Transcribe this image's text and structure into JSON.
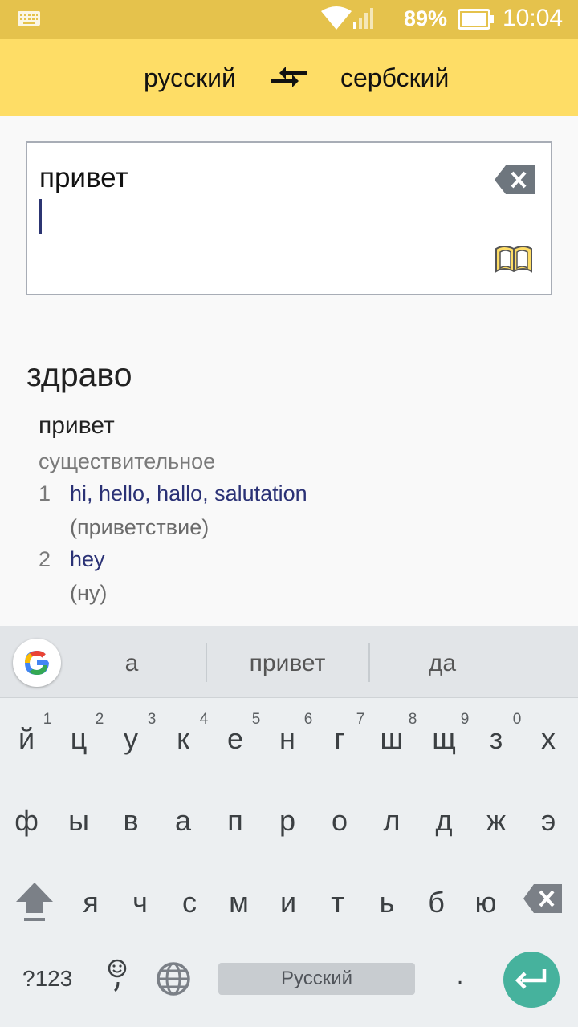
{
  "status_bar": {
    "battery": "89%",
    "time": "10:04",
    "icons": [
      "keyboard-icon",
      "wifi-icon",
      "signal-icon",
      "battery-icon"
    ]
  },
  "language_bar": {
    "source": "русский",
    "target": "сербский",
    "swap_icon": "swap-arrows-icon"
  },
  "input": {
    "text": "привет",
    "clear_icon": "backspace-clear-icon",
    "book_icon": "dictionary-book-icon"
  },
  "result": {
    "translation": "здраво",
    "entry": {
      "word": "привет",
      "part_of_speech": "существительное",
      "senses": [
        {
          "num": "1",
          "translations": "hi, hello, hallo, salutation",
          "gloss": "(приветствие)"
        },
        {
          "num": "2",
          "translations": "hey",
          "gloss": "(ну)"
        }
      ]
    }
  },
  "keyboard": {
    "suggestions": [
      "а",
      "привет",
      "да"
    ],
    "row1": [
      "й",
      "ц",
      "у",
      "к",
      "е",
      "н",
      "г",
      "ш",
      "щ",
      "з",
      "х"
    ],
    "row1_hints": [
      "1",
      "2",
      "3",
      "4",
      "5",
      "6",
      "7",
      "8",
      "9",
      "0"
    ],
    "row2": [
      "ф",
      "ы",
      "в",
      "а",
      "п",
      "р",
      "о",
      "л",
      "д",
      "ж",
      "э"
    ],
    "row3": [
      "я",
      "ч",
      "с",
      "м",
      "и",
      "т",
      "ь",
      "б",
      "ю"
    ],
    "symbols_label": "?123",
    "space_label": "Русский",
    "period_label": ".",
    "accent_color": "#46b29d"
  },
  "colors": {
    "status_bar": "#e5c24c",
    "header": "#fedd66",
    "translation_link": "#2a3175"
  }
}
